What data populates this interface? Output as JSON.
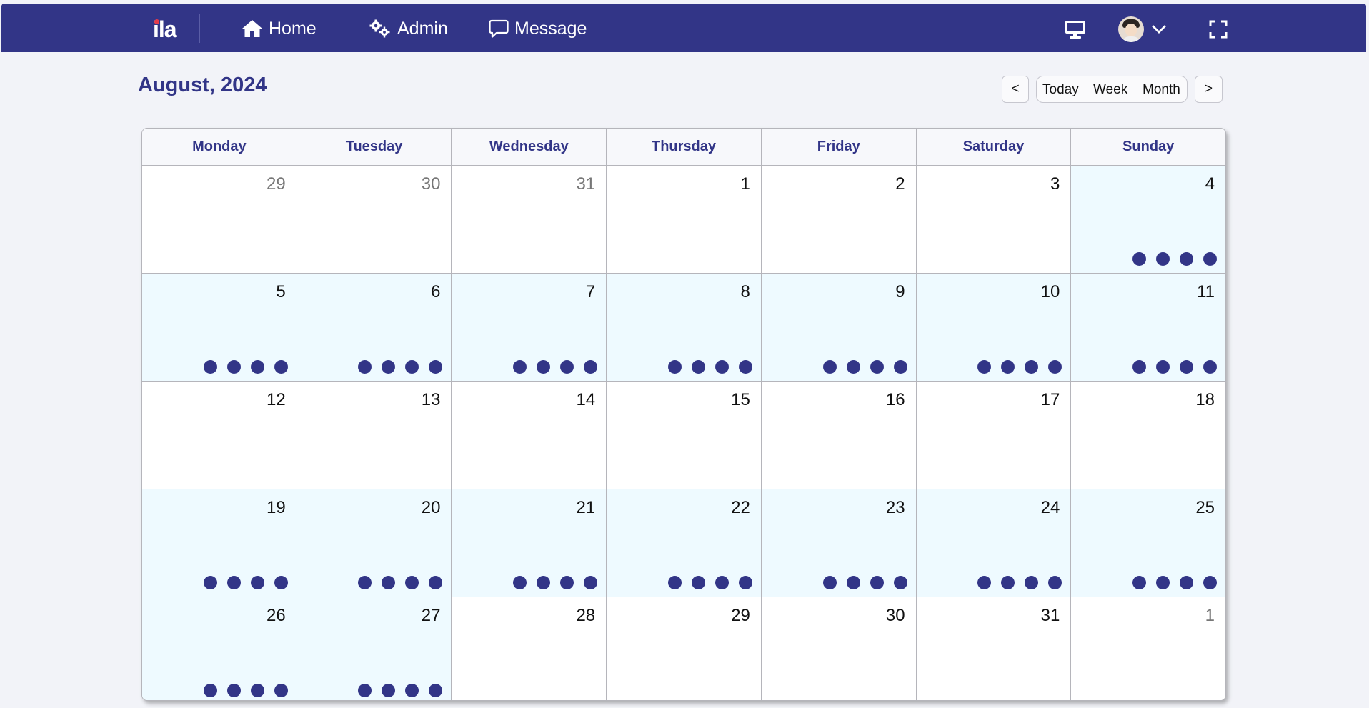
{
  "nav": {
    "logo": "ila",
    "items": [
      {
        "label": "Home",
        "icon": "home-icon"
      },
      {
        "label": "Admin",
        "icon": "gears-icon"
      },
      {
        "label": "Message",
        "icon": "chat-bubble-icon"
      }
    ],
    "right_icons": [
      "desktop-icon",
      "avatar",
      "chevron-down-icon",
      "fullscreen-icon"
    ]
  },
  "calendar": {
    "title": "August, 2024",
    "controls": {
      "prev": "<",
      "today": "Today",
      "week": "Week",
      "month": "Month",
      "next": ">"
    },
    "weekdays": [
      "Monday",
      "Tuesday",
      "Wednesday",
      "Thursday",
      "Friday",
      "Saturday",
      "Sunday"
    ],
    "weeks": [
      [
        {
          "day": "29",
          "other": true,
          "events": 0
        },
        {
          "day": "30",
          "other": true,
          "events": 0
        },
        {
          "day": "31",
          "other": true,
          "events": 0
        },
        {
          "day": "1",
          "events": 0
        },
        {
          "day": "2",
          "events": 0
        },
        {
          "day": "3",
          "events": 0
        },
        {
          "day": "4",
          "events": 4
        }
      ],
      [
        {
          "day": "5",
          "events": 4
        },
        {
          "day": "6",
          "events": 4
        },
        {
          "day": "7",
          "events": 4
        },
        {
          "day": "8",
          "events": 4
        },
        {
          "day": "9",
          "events": 4
        },
        {
          "day": "10",
          "events": 4
        },
        {
          "day": "11",
          "events": 4
        }
      ],
      [
        {
          "day": "12",
          "events": 0
        },
        {
          "day": "13",
          "events": 0
        },
        {
          "day": "14",
          "events": 0
        },
        {
          "day": "15",
          "events": 0
        },
        {
          "day": "16",
          "events": 0
        },
        {
          "day": "17",
          "events": 0
        },
        {
          "day": "18",
          "events": 0
        }
      ],
      [
        {
          "day": "19",
          "events": 4
        },
        {
          "day": "20",
          "events": 4
        },
        {
          "day": "21",
          "events": 4
        },
        {
          "day": "22",
          "events": 4
        },
        {
          "day": "23",
          "events": 4
        },
        {
          "day": "24",
          "events": 4
        },
        {
          "day": "25",
          "events": 4
        }
      ],
      [
        {
          "day": "26",
          "events": 4
        },
        {
          "day": "27",
          "events": 4
        },
        {
          "day": "28",
          "events": 0
        },
        {
          "day": "29",
          "events": 0
        },
        {
          "day": "30",
          "events": 0
        },
        {
          "day": "31",
          "events": 0
        },
        {
          "day": "1",
          "other": true,
          "events": 0
        }
      ]
    ]
  },
  "colors": {
    "primary": "#323587",
    "highlight": "#eefaff",
    "logo_dot": "#e43b4a"
  }
}
